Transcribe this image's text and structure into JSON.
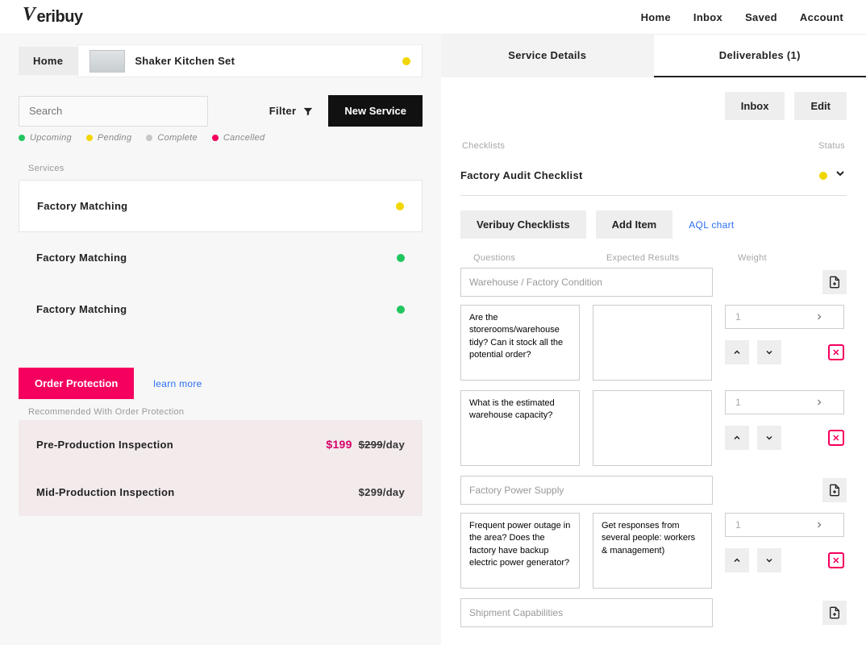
{
  "nav": {
    "home": "Home",
    "inbox": "Inbox",
    "saved": "Saved",
    "account": "Account",
    "brand": "eribuy"
  },
  "breadcrumb": {
    "home": "Home",
    "product": "Shaker Kitchen Set"
  },
  "search": {
    "placeholder": "Search",
    "filter": "Filter",
    "new_service": "New Service"
  },
  "legend": {
    "upcoming": "Upcoming",
    "pending": "Pending",
    "complete": "Complete",
    "cancelled": "Cancelled"
  },
  "services_label": "Services",
  "services": [
    {
      "name": "Factory Matching",
      "status": "pending"
    },
    {
      "name": "Factory Matching",
      "status": "upcoming"
    },
    {
      "name": "Factory Matching",
      "status": "upcoming"
    }
  ],
  "order_protection": {
    "button": "Order Protection",
    "learn": "learn more",
    "rec": "Recommended With Order Protection"
  },
  "inspections": [
    {
      "name": "Pre-Production Inspection",
      "price": "$199",
      "original": "$299",
      "per": "/day"
    },
    {
      "name": "Mid-Production Inspection",
      "price": "$299/day"
    }
  ],
  "tabs": {
    "details": "Service Details",
    "deliverables": "Deliverables (1)"
  },
  "rbtns": {
    "inbox": "Inbox",
    "edit": "Edit"
  },
  "checklist_header": {
    "left": "Checklists",
    "right": "Status"
  },
  "checklist": {
    "title": "Factory Audit Checklist"
  },
  "sub": {
    "veribuy": "Veribuy Checklists",
    "add": "Add Item",
    "aql": "AQL chart"
  },
  "cols3": {
    "q": "Questions",
    "r": "Expected Results",
    "w": "Weight"
  },
  "sections": [
    {
      "title": "Warehouse / Factory Condition",
      "items": [
        {
          "q": "Are the storerooms/warehouse tidy? Can it stock all the potential order?",
          "r": "",
          "w": "1"
        },
        {
          "q": "What is the estimated warehouse capacity?",
          "r": "",
          "w": "1"
        }
      ]
    },
    {
      "title": "Factory Power Supply",
      "items": [
        {
          "q": "Frequent power outage in the area? Does the factory have backup electric power generator?",
          "r": "Get responses from several people: workers & management)",
          "w": "1"
        }
      ]
    },
    {
      "title": "Shipment Capabilities",
      "items": []
    }
  ]
}
